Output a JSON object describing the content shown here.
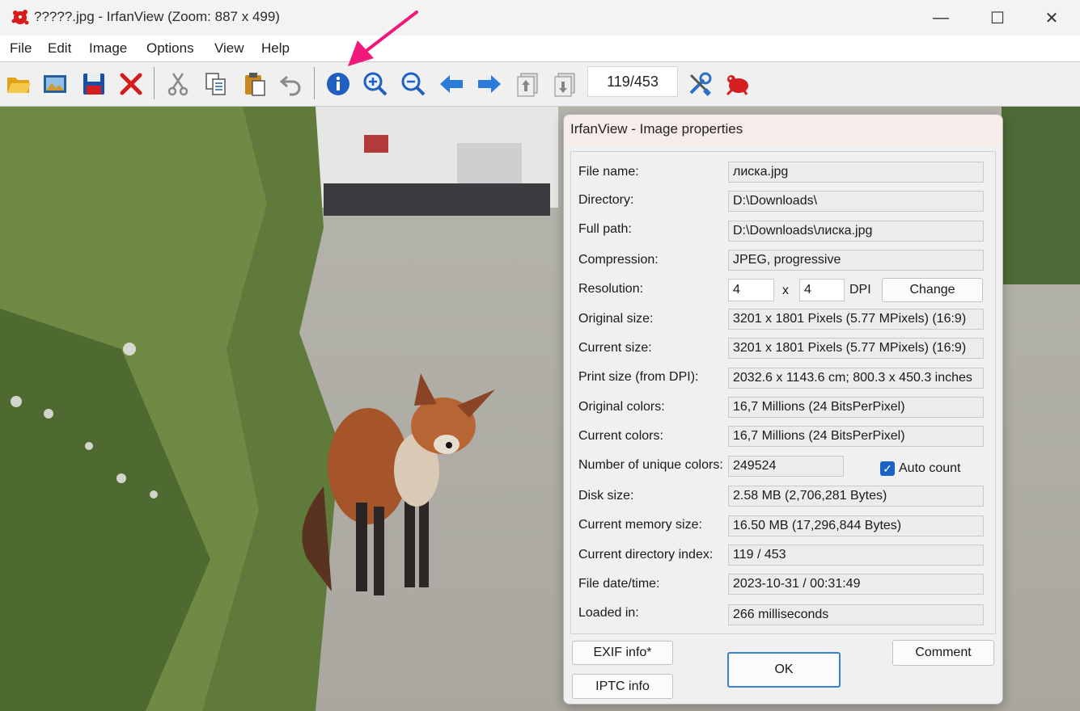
{
  "window": {
    "title": "?????.jpg - IrfanView (Zoom: 887 x 499)",
    "minimize_glyph": "—",
    "maximize_glyph": "☐",
    "close_glyph": "✕"
  },
  "menu": [
    "File",
    "Edit",
    "Image",
    "Options",
    "View",
    "Help"
  ],
  "toolbar": {
    "icons": [
      "open-icon",
      "thumbnails-icon",
      "save-icon",
      "delete-icon",
      "cut-icon",
      "copy-icon",
      "paste-icon",
      "undo-icon",
      "info-icon",
      "zoom-in-icon",
      "zoom-out-icon",
      "previous-icon",
      "next-icon",
      "first-page-icon",
      "last-page-icon",
      "settings-icon",
      "irfanview-logo-icon"
    ],
    "counter": "119/453"
  },
  "dialog": {
    "title": "IrfanView - Image properties",
    "properties": {
      "file_name": {
        "label": "File name:",
        "value": "лиска.jpg"
      },
      "directory": {
        "label": "Directory:",
        "value": "D:\\Downloads\\"
      },
      "full_path": {
        "label": "Full path:",
        "value": "D:\\Downloads\\лиска.jpg"
      },
      "compression": {
        "label": "Compression:",
        "value": "JPEG, progressive"
      },
      "resolution": {
        "label": "Resolution:",
        "x": "4",
        "y": "4",
        "separator": "x",
        "unit": "DPI",
        "change_button": "Change"
      },
      "original_size": {
        "label": "Original size:",
        "value": "3201 x 1801  Pixels (5.77 MPixels) (16:9)"
      },
      "current_size": {
        "label": "Current size:",
        "value": "3201 x 1801  Pixels (5.77 MPixels) (16:9)"
      },
      "print_size": {
        "label": "Print size (from DPI):",
        "value": "2032.6 x 1143.6 cm; 800.3 x 450.3 inches"
      },
      "original_colors": {
        "label": "Original colors:",
        "value": "16,7 Millions   (24 BitsPerPixel)"
      },
      "current_colors": {
        "label": "Current colors:",
        "value": "16,7 Millions   (24 BitsPerPixel)"
      },
      "unique_colors": {
        "label": "Number of unique colors:",
        "value": "249524",
        "auto_count_label": "Auto count",
        "auto_count_checked": true
      },
      "disk_size": {
        "label": "Disk size:",
        "value": "2.58 MB (2,706,281 Bytes)"
      },
      "memory_size": {
        "label": "Current memory size:",
        "value": "16.50  MB (17,296,844 Bytes)"
      },
      "dir_index": {
        "label": "Current directory index:",
        "value": "119  /  453"
      },
      "file_datetime": {
        "label": "File date/time:",
        "value": "2023-10-31 / 00:31:49"
      },
      "loaded_in": {
        "label": "Loaded in:",
        "value": "266 milliseconds"
      }
    },
    "buttons": {
      "exif": "EXIF info*",
      "iptc": "IPTC info",
      "ok": "OK",
      "comment": "Comment"
    }
  },
  "colors": {
    "annotation_arrow": "#f0187a",
    "accent": "#1a62c3"
  }
}
